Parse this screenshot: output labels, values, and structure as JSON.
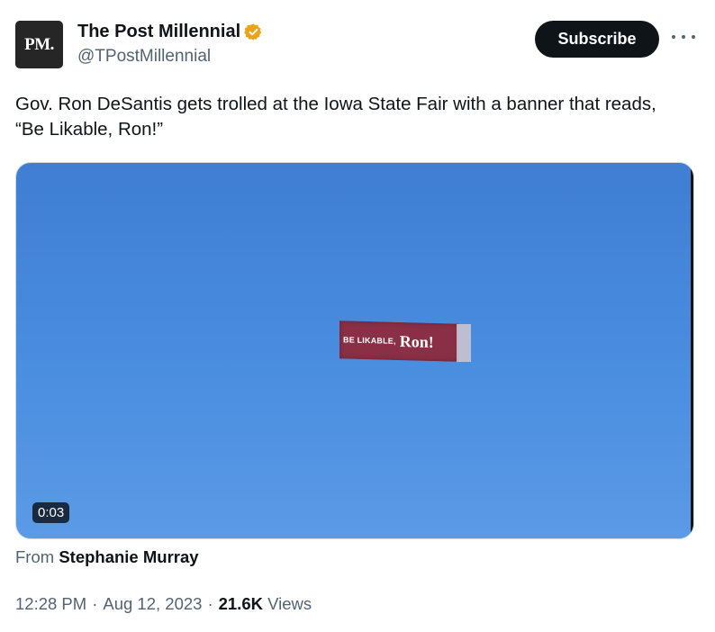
{
  "author": {
    "avatar_text": "PM.",
    "display_name": "The Post Millennial",
    "handle": "@TPostMillennial"
  },
  "subscribe_label": "Subscribe",
  "tweet": {
    "text": "Gov. Ron DeSantis gets trolled at the Iowa State Fair with a banner that reads, “Be Likable, Ron!”"
  },
  "media": {
    "banner_small_text": "BE LIKABLE,",
    "banner_big_text": "Ron!",
    "duration": "0:03"
  },
  "attribution": {
    "prefix": "From",
    "source": "Stephanie Murray"
  },
  "meta": {
    "time": "12:28 PM",
    "sep1": "·",
    "date": "Aug 12, 2023",
    "sep2": "·",
    "views_count": "21.6K",
    "views_label": "Views"
  },
  "colors": {
    "verified_badge": "#e8a51b",
    "subscribe_bg": "#0f1419",
    "sky": "#4a8ee0",
    "banner": "#8a2f45"
  },
  "icons": {
    "verified": "verified-badge-icon",
    "more": "more-horizontal-icon"
  }
}
